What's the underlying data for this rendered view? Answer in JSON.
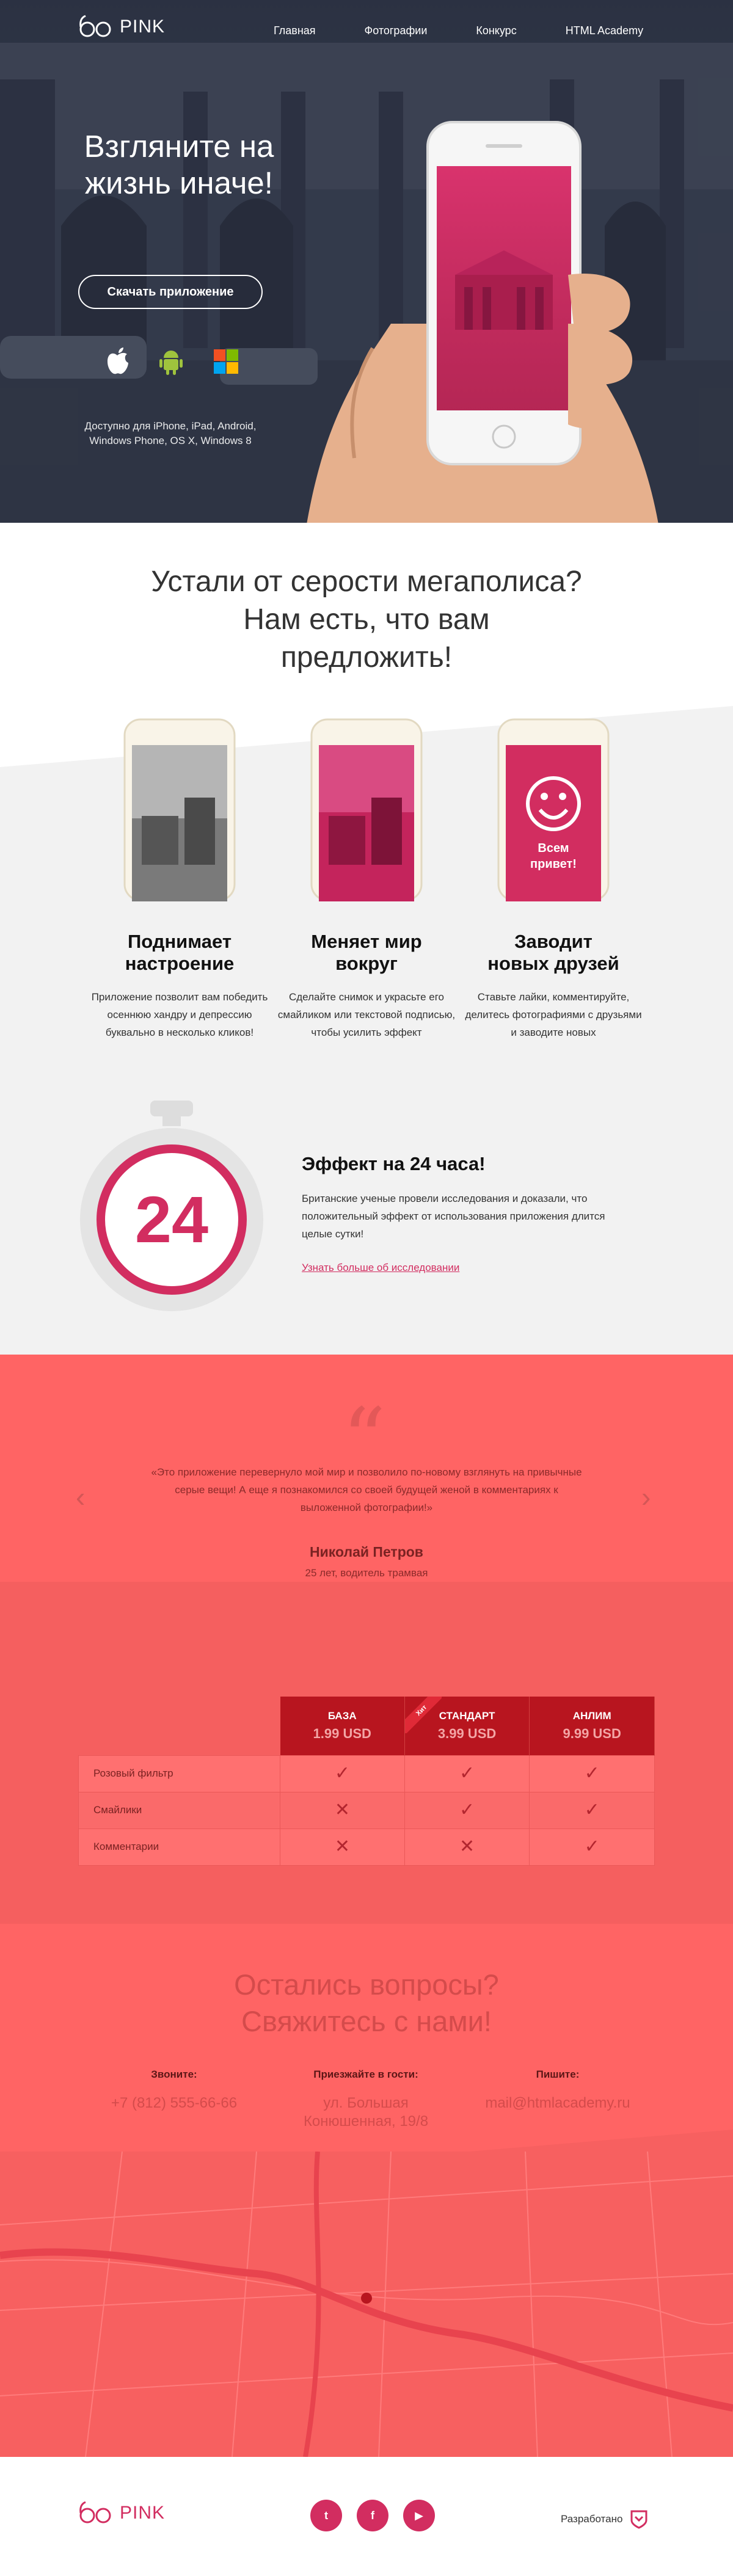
{
  "brand": {
    "name": "PINK"
  },
  "nav": {
    "items": [
      {
        "label": "Главная"
      },
      {
        "label": "Фотографии"
      },
      {
        "label": "Конкурс"
      },
      {
        "label": "HTML Academy"
      }
    ]
  },
  "hero": {
    "title": "Взгляните на жизнь иначе!",
    "download_button": "Скачать приложение",
    "platforms": [
      "apple-icon",
      "android-icon",
      "windows-icon"
    ],
    "available": "Доступно для iPhone, iPad, Android, Windows Phone, OS X, Windows 8"
  },
  "features": {
    "title_line1": "Устали от серости мегаполиса?",
    "title_line2": "Нам есть, что вам",
    "title_line3": "предложить!",
    "items": [
      {
        "title_line1": "Поднимает",
        "title_line2": "настроение",
        "text": "Приложение позволит вам победить осеннюю хандру и депрессию буквально в несколько кликов!"
      },
      {
        "title_line1": "Меняет мир",
        "title_line2": "вокруг",
        "text": "Сделайте снимок и украсьте его смайликом или текстовой подписью, чтобы усилить эффект"
      },
      {
        "title_line1": "Заводит",
        "title_line2": "новых друзей",
        "text": "Ставьте лайки, комментируйте, делитесь фотографиями с друзьями и заводите новых"
      }
    ],
    "phone3_label_line1": "Всем",
    "phone3_label_line2": "привет!"
  },
  "effect": {
    "number": "24",
    "title": "Эффект на 24 часа!",
    "text": "Британские ученые провели исследования и доказали, что положительный эффект от использования приложения длится целые сутки!",
    "link": "Узнать больше об исследовании"
  },
  "review": {
    "quote": "«Это приложение перевернуло мой мир и позволило по-новому взглянуть на привычные серые вещи! А еще я познакомился со своей будущей женой в комментариях к выложенной фотографии!»",
    "author": "Николай Петров",
    "role": "25 лет, водитель трамвая"
  },
  "prices": {
    "badge": "Хит",
    "plans": [
      {
        "name": "БАЗА",
        "price": "1.99 USD"
      },
      {
        "name": "СТАНДАРТ",
        "price": "3.99 USD"
      },
      {
        "name": "АНЛИМ",
        "price": "9.99 USD"
      }
    ],
    "rows": [
      {
        "feature": "Розовый фильтр",
        "values": [
          true,
          true,
          true
        ]
      },
      {
        "feature": "Смайлики",
        "values": [
          false,
          true,
          true
        ]
      },
      {
        "feature": "Комментарии",
        "values": [
          false,
          false,
          true
        ]
      }
    ]
  },
  "contacts": {
    "title_line1": "Остались вопросы?",
    "title_line2": "Свяжитесь с нами!",
    "call": {
      "label": "Звоните:",
      "value": "+7 (812) 555-66-66"
    },
    "visit": {
      "label": "Приезжайте в гости:",
      "value_line1": "ул. Большая",
      "value_line2": "Конюшенная, 19/8"
    },
    "write": {
      "label": "Пишите:",
      "value": "mail@htmlacademy.ru"
    }
  },
  "footer": {
    "developed": "Разработано",
    "socials": [
      {
        "icon": "twitter-icon",
        "glyph": "t"
      },
      {
        "icon": "facebook-icon",
        "glyph": "f"
      },
      {
        "icon": "youtube-icon",
        "glyph": "▶"
      }
    ]
  },
  "colors": {
    "brand_pink": "#d22d60",
    "red": "#ff6464",
    "dark_red": "#b8151f"
  }
}
